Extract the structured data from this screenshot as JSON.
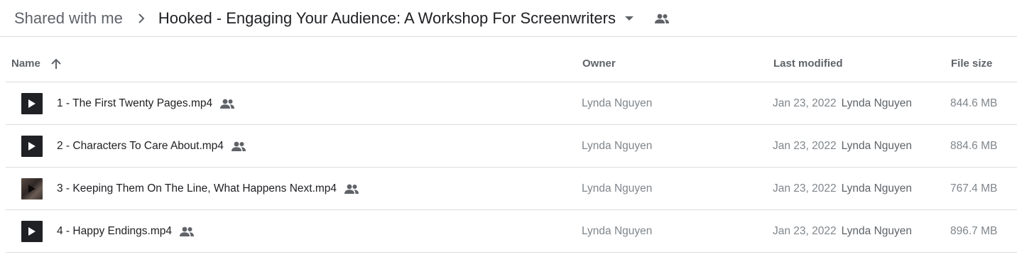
{
  "breadcrumb": {
    "root": "Shared with me",
    "current": "Hooked - Engaging Your Audience: A Workshop For Screenwriters"
  },
  "columns": {
    "name": "Name",
    "owner": "Owner",
    "last_modified": "Last modified",
    "file_size": "File size"
  },
  "sort": {
    "column": "name",
    "direction": "ascending"
  },
  "colors": {
    "text_primary": "#202124",
    "text_secondary": "#5f6368",
    "text_muted": "#80868b",
    "divider": "#dadce0"
  },
  "files": [
    {
      "name": "1 - The First Twenty Pages.mp4",
      "owner": "Lynda Nguyen",
      "modified_date": "Jan 23, 2022",
      "modified_by": "Lynda Nguyen",
      "size": "844.6 MB",
      "thumbnail": "play-icon"
    },
    {
      "name": "2 - Characters To Care About.mp4",
      "owner": "Lynda Nguyen",
      "modified_date": "Jan 23, 2022",
      "modified_by": "Lynda Nguyen",
      "size": "884.6 MB",
      "thumbnail": "play-icon"
    },
    {
      "name": "3 - Keeping Them On The Line, What Happens Next.mp4",
      "owner": "Lynda Nguyen",
      "modified_date": "Jan 23, 2022",
      "modified_by": "Lynda Nguyen",
      "size": "767.4 MB",
      "thumbnail": "video-thumbnail"
    },
    {
      "name": "4 - Happy Endings.mp4",
      "owner": "Lynda Nguyen",
      "modified_date": "Jan 23, 2022",
      "modified_by": "Lynda Nguyen",
      "size": "896.7 MB",
      "thumbnail": "play-icon"
    }
  ]
}
